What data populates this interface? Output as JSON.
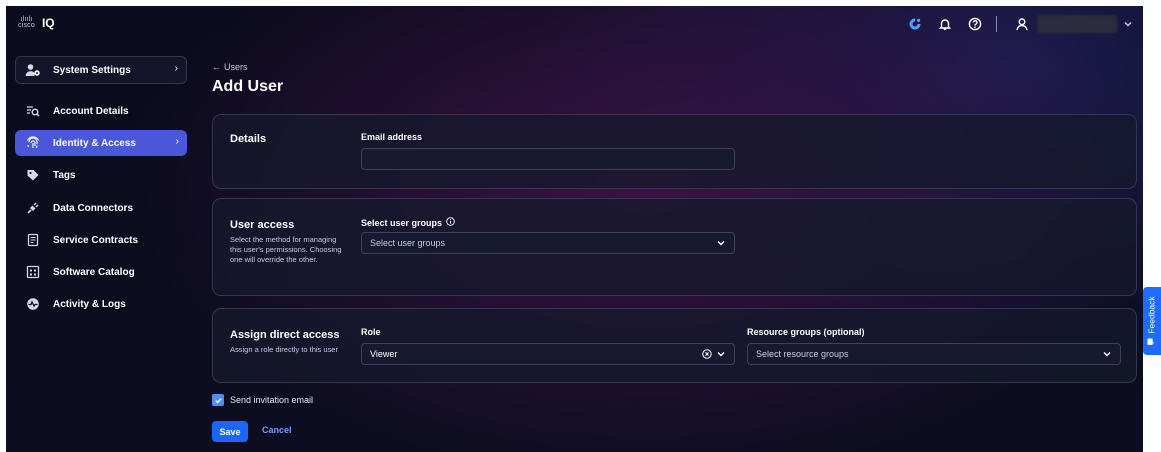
{
  "app": {
    "brand": "cisco",
    "name": "IQ"
  },
  "colors": {
    "accent": "#4a57d9",
    "primary_button": "#1a66ff",
    "link": "#6f9fff",
    "feedback": "#1f6bff"
  },
  "topbar": {
    "icons": [
      "status-icon",
      "bell-icon",
      "help-icon",
      "user-icon",
      "chevron-down-icon"
    ]
  },
  "sidebar": {
    "header": {
      "label": "System Settings",
      "icon": "user-settings-icon"
    },
    "items": [
      {
        "label": "Account Details",
        "icon": "account-search-icon",
        "active": false
      },
      {
        "label": "Identity & Access",
        "icon": "fingerprint-icon",
        "active": true
      },
      {
        "label": "Tags",
        "icon": "tag-icon",
        "active": false
      },
      {
        "label": "Data Connectors",
        "icon": "plug-icon",
        "active": false
      },
      {
        "label": "Service Contracts",
        "icon": "contract-icon",
        "active": false
      },
      {
        "label": "Software Catalog",
        "icon": "catalog-icon",
        "active": false
      },
      {
        "label": "Activity & Logs",
        "icon": "activity-icon",
        "active": false
      }
    ]
  },
  "main": {
    "back_label": "Users",
    "title": "Add User",
    "details": {
      "title": "Details",
      "email_label": "Email address",
      "email_value": ""
    },
    "user_access": {
      "title": "User access",
      "description": "Select the method for managing this user's permissions. Choosing one will override the other.",
      "groups_label": "Select user groups",
      "groups_placeholder": "Select user groups"
    },
    "direct_access": {
      "title": "Assign direct access",
      "description": "Assign a role directly to this user",
      "role_label": "Role",
      "role_value": "Viewer",
      "resource_label": "Resource groups (optional)",
      "resource_placeholder": "Select resource groups"
    },
    "send_invitation": {
      "label": "Send invitation email",
      "checked": true
    },
    "save_label": "Save",
    "cancel_label": "Cancel"
  },
  "feedback": {
    "label": "Feedback"
  }
}
